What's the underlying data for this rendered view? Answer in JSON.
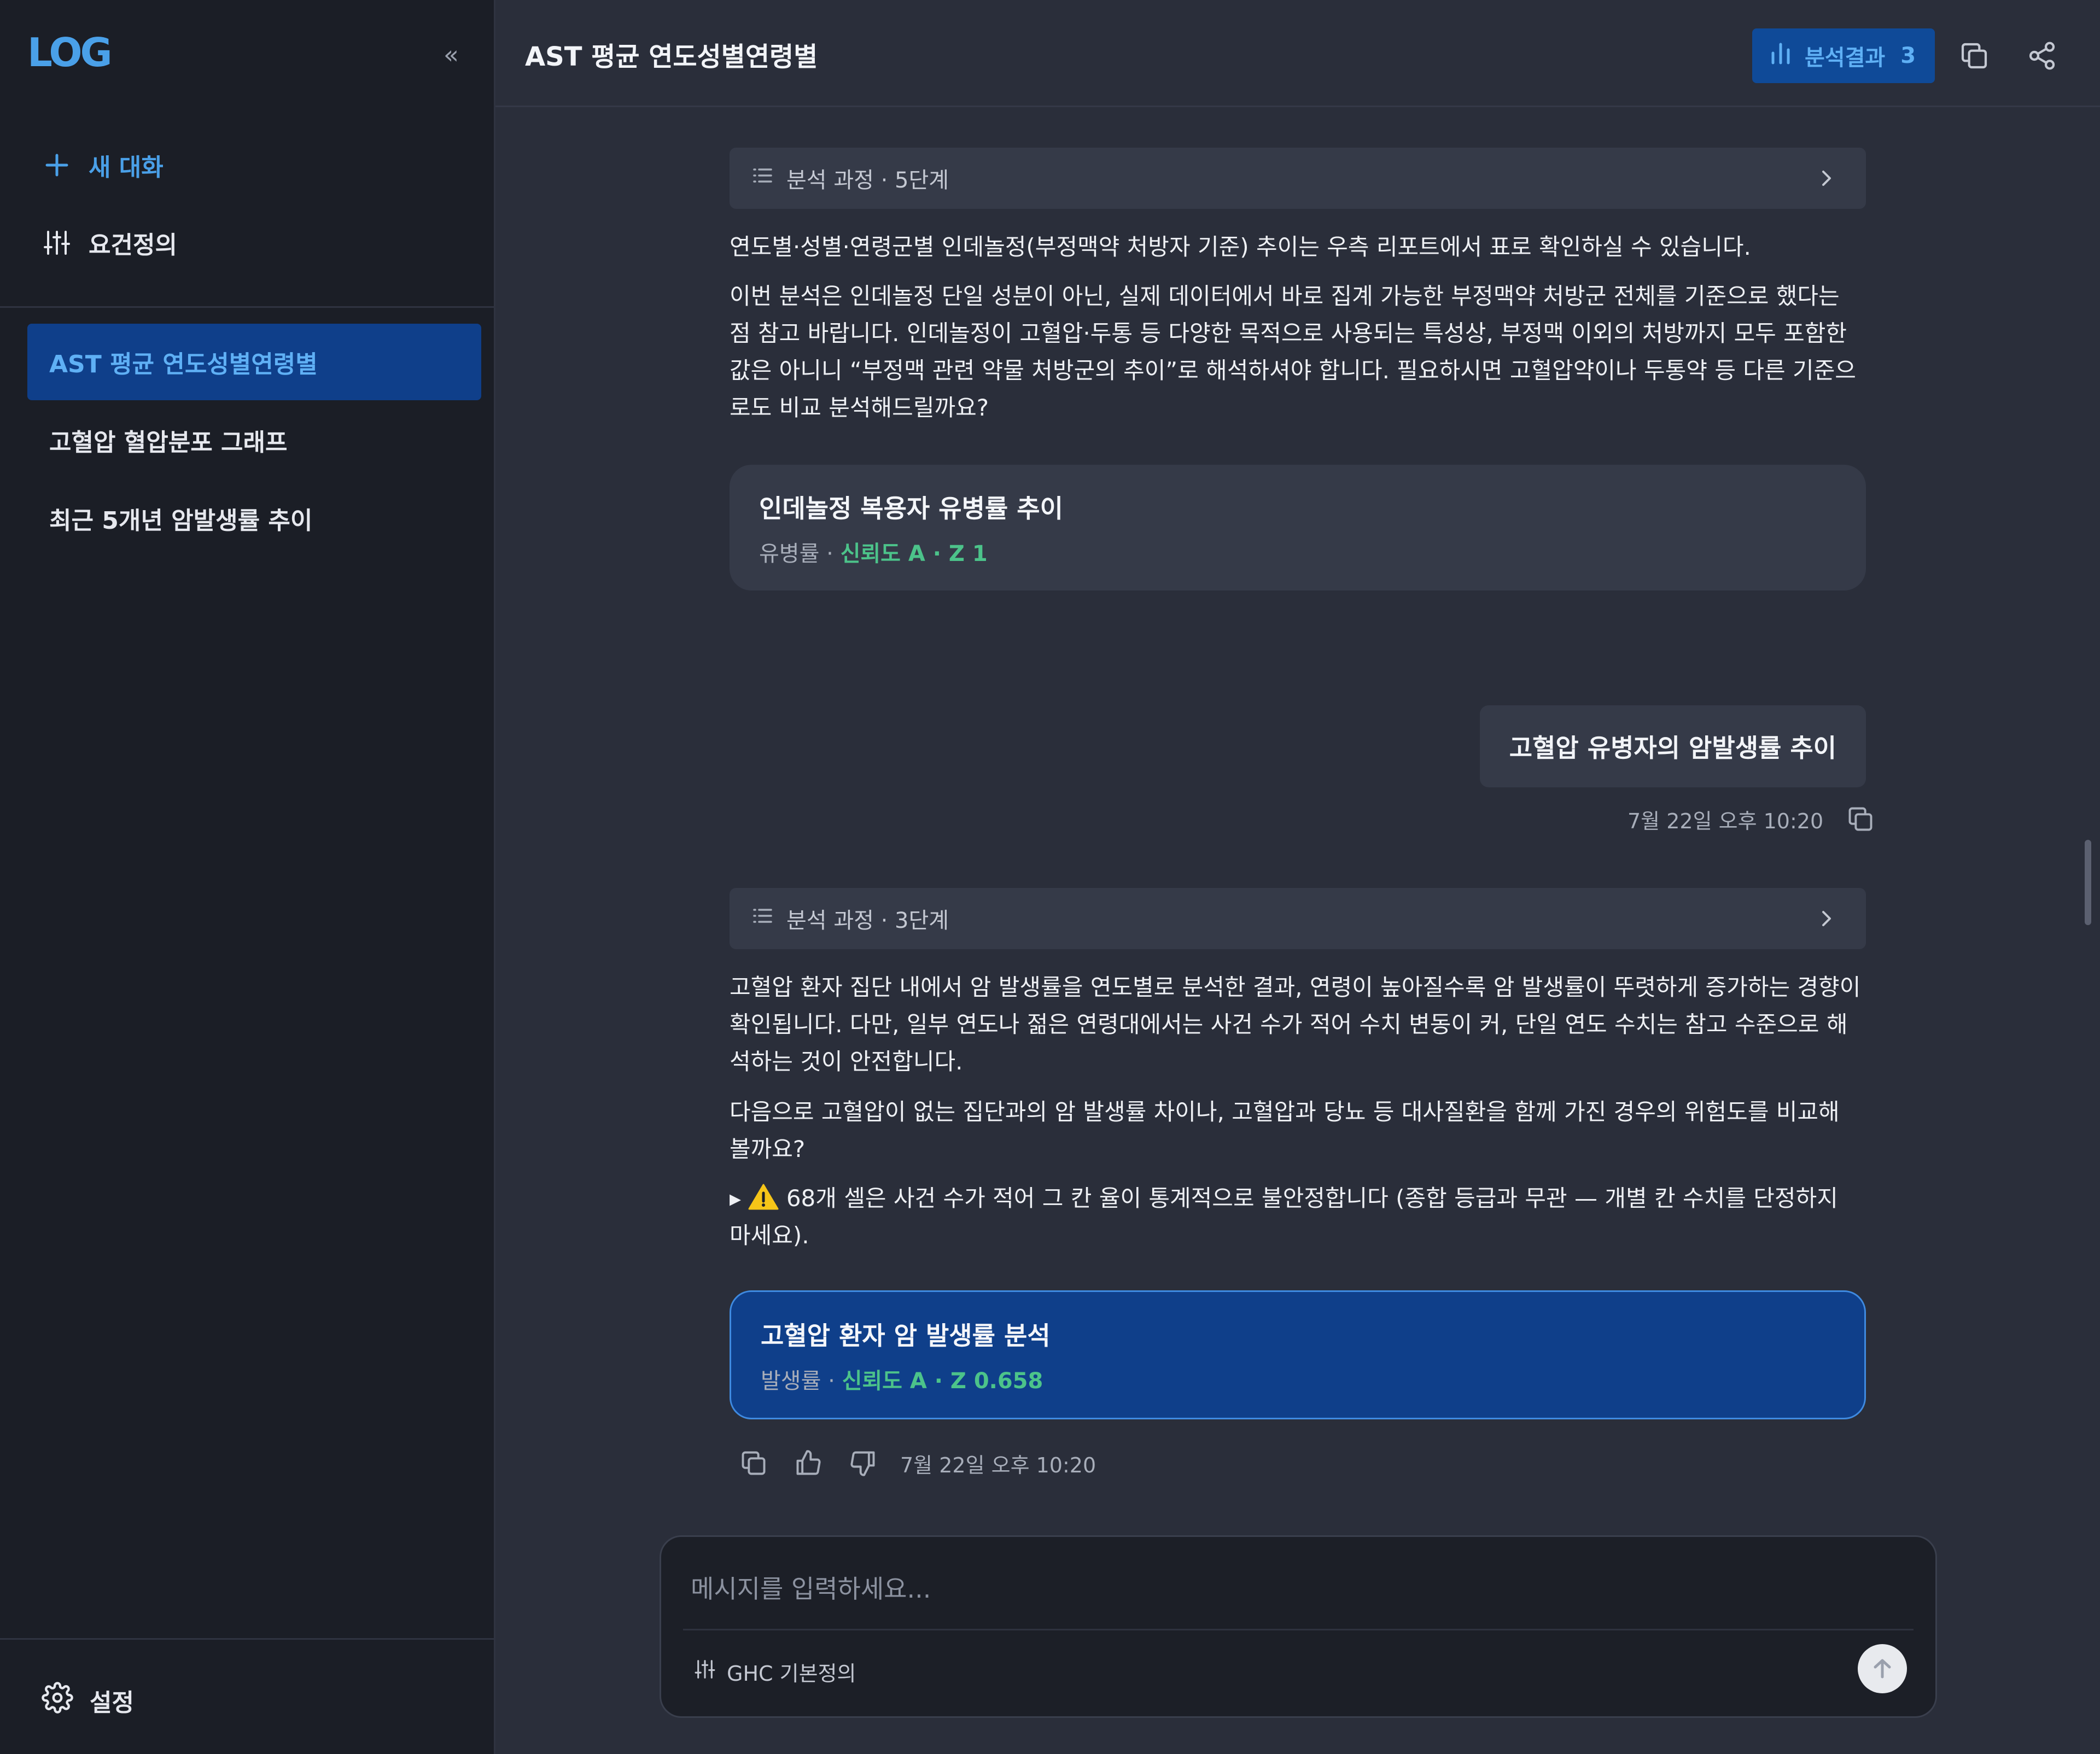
{
  "sidebar": {
    "logo": "LOG",
    "collapse": "«",
    "new_chat": "새 대화",
    "requirements": "요건정의",
    "conversations": [
      {
        "label": "AST 평균 연도성별연령별",
        "active": true
      },
      {
        "label": "고혈압 혈압분포 그래프",
        "active": false
      },
      {
        "label": "최근 5개년 암발생률 추이",
        "active": false
      }
    ],
    "settings": "설정"
  },
  "header": {
    "title": "AST 평균 연도성별연령별",
    "results_label": "분석결과",
    "results_count": "3"
  },
  "messages": {
    "process1": "분석 과정 · 5단계",
    "answer1_p1": "연도별·성별·연령군별 인데놀정(부정맥약 처방자 기준) 추이는 우측 리포트에서 표로 확인하실 수 있습니다.",
    "answer1_p2": "이번 분석은 인데놀정 단일 성분이 아닌, 실제 데이터에서 바로 집계 가능한 부정맥약 처방군 전체를 기준으로 했다는 점 참고 바랍니다. 인데놀정이 고혈압·두통 등 다양한 목적으로 사용되는 특성상, 부정맥 이외의 처방까지 모두 포함한 값은 아니니 “부정맥 관련 약물 처방군의 추이”로 해석하셔야 합니다. 필요하시면 고혈압약이나 두통약 등 다른 기준으로도 비교 분석해드릴까요?",
    "card1": {
      "title": "인데놀정 복용자 유병률 추이",
      "metric": "유병률",
      "confidence": "신뢰도 A · Z 1"
    },
    "user_msg": "고혈압 유병자의 암발생률 추이",
    "user_time": "7월 22일 오후 10:20",
    "process2": "분석 과정 · 3단계",
    "answer2_p1": "고혈압 환자 집단 내에서 암 발생률을 연도별로 분석한 결과, 연령이 높아질수록 암 발생률이 뚜렷하게 증가하는 경향이 확인됩니다. 다만, 일부 연도나 젊은 연령대에서는 사건 수가 적어 수치 변동이 커, 단일 연도 수치는 참고 수준으로 해석하는 것이 안전합니다.",
    "answer2_p2": "다음으로 고혈압이 없는 집단과의 암 발생률 차이나, 고혈압과 당뇨 등 대사질환을 함께 가진 경우의 위험도를 비교해 볼까요?",
    "answer2_warning_bullet": "▸",
    "answer2_warning": "68개 셀은 사건 수가 적어 그 칸 율이 통계적으로 불안정합니다 (종합 등급과 무관 — 개별 칸 수치를 단정하지 마세요).",
    "card2": {
      "title": "고혈압 환자 암 발생률 분석",
      "metric": "발생률",
      "confidence": "신뢰도 A · Z 0.658"
    },
    "answer_time": "7월 22일 오후 10:20"
  },
  "composer": {
    "placeholder": "메시지를 입력하세요...",
    "preset": "GHC 기본정의"
  },
  "colors": {
    "accent": "#4aa0e8",
    "active_bg": "#0f3f8a",
    "confidence_green": "#4cc38a",
    "warning": "#f5c518"
  }
}
